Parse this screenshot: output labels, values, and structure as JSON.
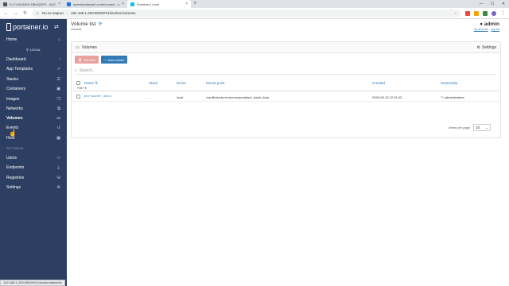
{
  "browser": {
    "tabs": [
      {
        "title": "ILO USUARIO DBHQDFS - ADCCTH",
        "icon": "document-icon"
      },
      {
        "title": "openmediavault control panel - openm",
        "icon": "omv-icon"
      },
      {
        "title": "Portainer | local",
        "icon": "portainer-icon"
      }
    ],
    "new_tab": "+",
    "security": "No es seguro",
    "url": "192.168.1.200:9000/#!/1/docker/volumes",
    "status_url": "192.168.1.200:9000/#!/1/docker/networks"
  },
  "sidebar": {
    "logo": "portainer.io",
    "endpoint": "LOCAL",
    "home": "Home",
    "items": [
      {
        "label": "Dashboard",
        "icon": "tachometer-icon"
      },
      {
        "label": "App Templates",
        "icon": "rocket-icon"
      },
      {
        "label": "Stacks",
        "icon": "th-list-icon"
      },
      {
        "label": "Containers",
        "icon": "cubes-icon"
      },
      {
        "label": "Images",
        "icon": "clone-icon"
      },
      {
        "label": "Networks",
        "icon": "sitemap-icon"
      },
      {
        "label": "Volumes",
        "icon": "hdd-icon"
      },
      {
        "label": "Events",
        "icon": "history-icon"
      },
      {
        "label": "Host",
        "icon": "th-icon"
      }
    ],
    "settings_section": "SETTINGS",
    "settings_items": [
      {
        "label": "Users",
        "icon": "users-icon"
      },
      {
        "label": "Endpoints",
        "icon": "plug-icon"
      },
      {
        "label": "Registries",
        "icon": "database-icon"
      },
      {
        "label": "Settings",
        "icon": "cogs-icon"
      }
    ]
  },
  "header": {
    "title": "Volume list",
    "subtitle": "Volumes",
    "user": "admin",
    "my_account": "my account",
    "logout": "log out"
  },
  "widget": {
    "title": "Volumes",
    "settings": "Settings",
    "remove": "Remove",
    "add": "Add volume",
    "search_placeholder": "Search...",
    "columns": [
      "Name",
      "Stack",
      "Driver",
      "Mount point",
      "Created",
      "Ownership"
    ],
    "filter": "Filter",
    "rows": [
      {
        "name": "portainer_data",
        "stack": "-",
        "driver": "local",
        "mount": "/var/lib/docker/volumes/portainer_data/_data",
        "created": "2020-08-13 12:31:42",
        "ownership": "administrators"
      }
    ],
    "items_per_page_label": "Items per page",
    "items_per_page": "10"
  }
}
